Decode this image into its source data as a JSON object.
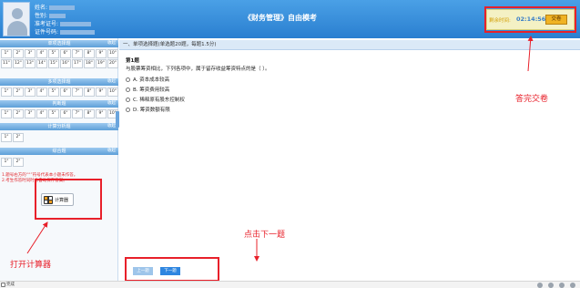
{
  "header": {
    "info_labels": [
      "姓名:",
      "性别:",
      "准考证号:",
      "证件号码:"
    ],
    "exam_title": "《财务管理》自由模考",
    "timer_label": "剩余时间:",
    "timer_value": "02:14:56",
    "submit_label": "交卷"
  },
  "sidebar": {
    "sections": [
      {
        "title": "单项选择题",
        "collapse": "收起",
        "questions": [
          "1°",
          "2°",
          "3°",
          "4°",
          "5°",
          "6°",
          "7°",
          "8°",
          "9°",
          "10°",
          "11°",
          "12°",
          "13°",
          "14°",
          "15°",
          "16°",
          "17°",
          "18°",
          "19°",
          "20°"
        ]
      },
      {
        "title": "多项选择题",
        "collapse": "收起",
        "questions": [
          "1°",
          "2°",
          "3°",
          "4°",
          "5°",
          "6°",
          "7°",
          "8°",
          "9°",
          "10°"
        ]
      },
      {
        "title": "判断题",
        "collapse": "收起",
        "questions": [
          "1°",
          "2°",
          "3°",
          "4°",
          "5°",
          "6°",
          "7°",
          "8°",
          "9°",
          "10°"
        ]
      },
      {
        "title": "计算分析题",
        "collapse": "收起",
        "questions": [
          "1°",
          "2°"
        ]
      },
      {
        "title": "综合题",
        "collapse": "收起",
        "questions": [
          "1°",
          "2°"
        ]
      }
    ],
    "tips": [
      "1.题号右方的“°”符号代表本小题未作答。",
      "2.考生作答时同时会自动保存答案。"
    ],
    "calculator_label": "计算器"
  },
  "question": {
    "section_header": "一、单项选择题(单选题20题，每题1.5分)",
    "number": "第1题",
    "stem": "与股票筹资相比，下列各项中，属于留存收益筹资特点的是（ ）。",
    "options": [
      "A. 资本成本较高",
      "B. 筹资费用较高",
      "C. 稀释原有股东控制权",
      "D. 筹资数额有限"
    ]
  },
  "nav": {
    "prev_label": "上一题",
    "next_label": "下一题"
  },
  "annotations": {
    "submit_hint": "答完交卷",
    "next_hint": "点击下一题",
    "calculator_hint": "打开计算器"
  },
  "status": {
    "text": "完成"
  },
  "colors": {
    "header_blue": "#2a7fd0",
    "annotation_red": "#e8202a",
    "timer_yellow": "#f4f1c4",
    "submit_orange": "#f0b323"
  }
}
